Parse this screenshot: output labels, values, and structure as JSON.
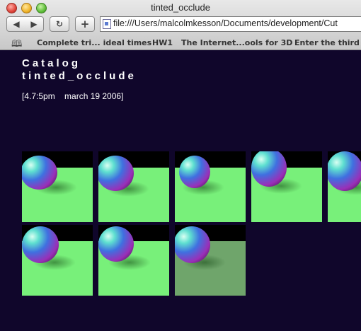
{
  "window": {
    "title": "tinted_occlude"
  },
  "toolbar": {
    "back_icon": "back-arrow-icon",
    "forward_icon": "forward-arrow-icon",
    "reload_icon": "reload-icon",
    "add_icon": "add-bookmark-icon",
    "url": "file:///Users/malcolmkesson/Documents/development/Cut"
  },
  "bookmarks": [
    "Complete tri... ideal times",
    "HW1",
    "The Internet...ools for 3D",
    "Enter the third d"
  ],
  "page": {
    "heading_line1": "Catalog",
    "heading_line2": "tinted_occlude",
    "dateline": "[4.7:5pm    march 19 2006]"
  },
  "thumbnails": [
    {
      "row": 1,
      "col": 1
    },
    {
      "row": 1,
      "col": 2
    },
    {
      "row": 1,
      "col": 3
    },
    {
      "row": 1,
      "col": 4
    },
    {
      "row": 1,
      "col": 5
    },
    {
      "row": 2,
      "col": 1
    },
    {
      "row": 2,
      "col": 2
    },
    {
      "row": 2,
      "col": 3,
      "tint": "dim"
    }
  ]
}
